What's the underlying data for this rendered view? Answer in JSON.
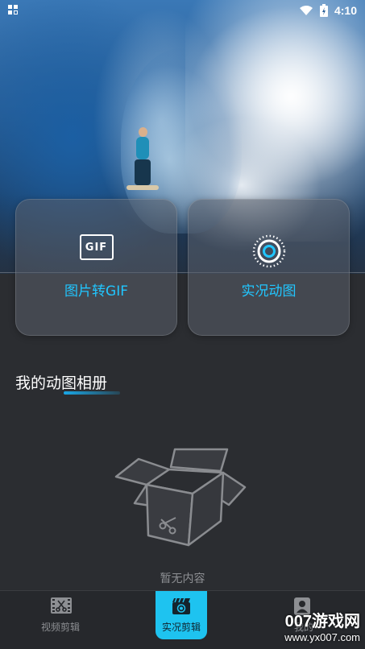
{
  "status_bar": {
    "time": "4:10",
    "icons": [
      "notification-grid-icon",
      "wifi-icon",
      "battery-charging-icon"
    ]
  },
  "features": [
    {
      "label": "图片转GIF",
      "icon": "gif-icon",
      "icon_text": "GIF"
    },
    {
      "label": "实况动图",
      "icon": "live-photo-icon"
    }
  ],
  "album": {
    "title": "我的动图相册",
    "empty_text": "暂无内容",
    "empty_icon": "empty-box-icon"
  },
  "bottom_nav": [
    {
      "label": "视频剪辑",
      "icon": "film-scissors-icon",
      "active": false
    },
    {
      "label": "实况剪辑",
      "icon": "live-clapper-icon",
      "active": true
    },
    {
      "label": "我的",
      "icon": "user-icon",
      "active": false
    }
  ],
  "watermark": {
    "text": "007游戏网",
    "url": "www.yx007.com"
  },
  "colors": {
    "accent": "#21C6FF",
    "background": "#2B2D31",
    "nav_active": "#1EC3F0",
    "muted_text": "#8D8F93"
  }
}
